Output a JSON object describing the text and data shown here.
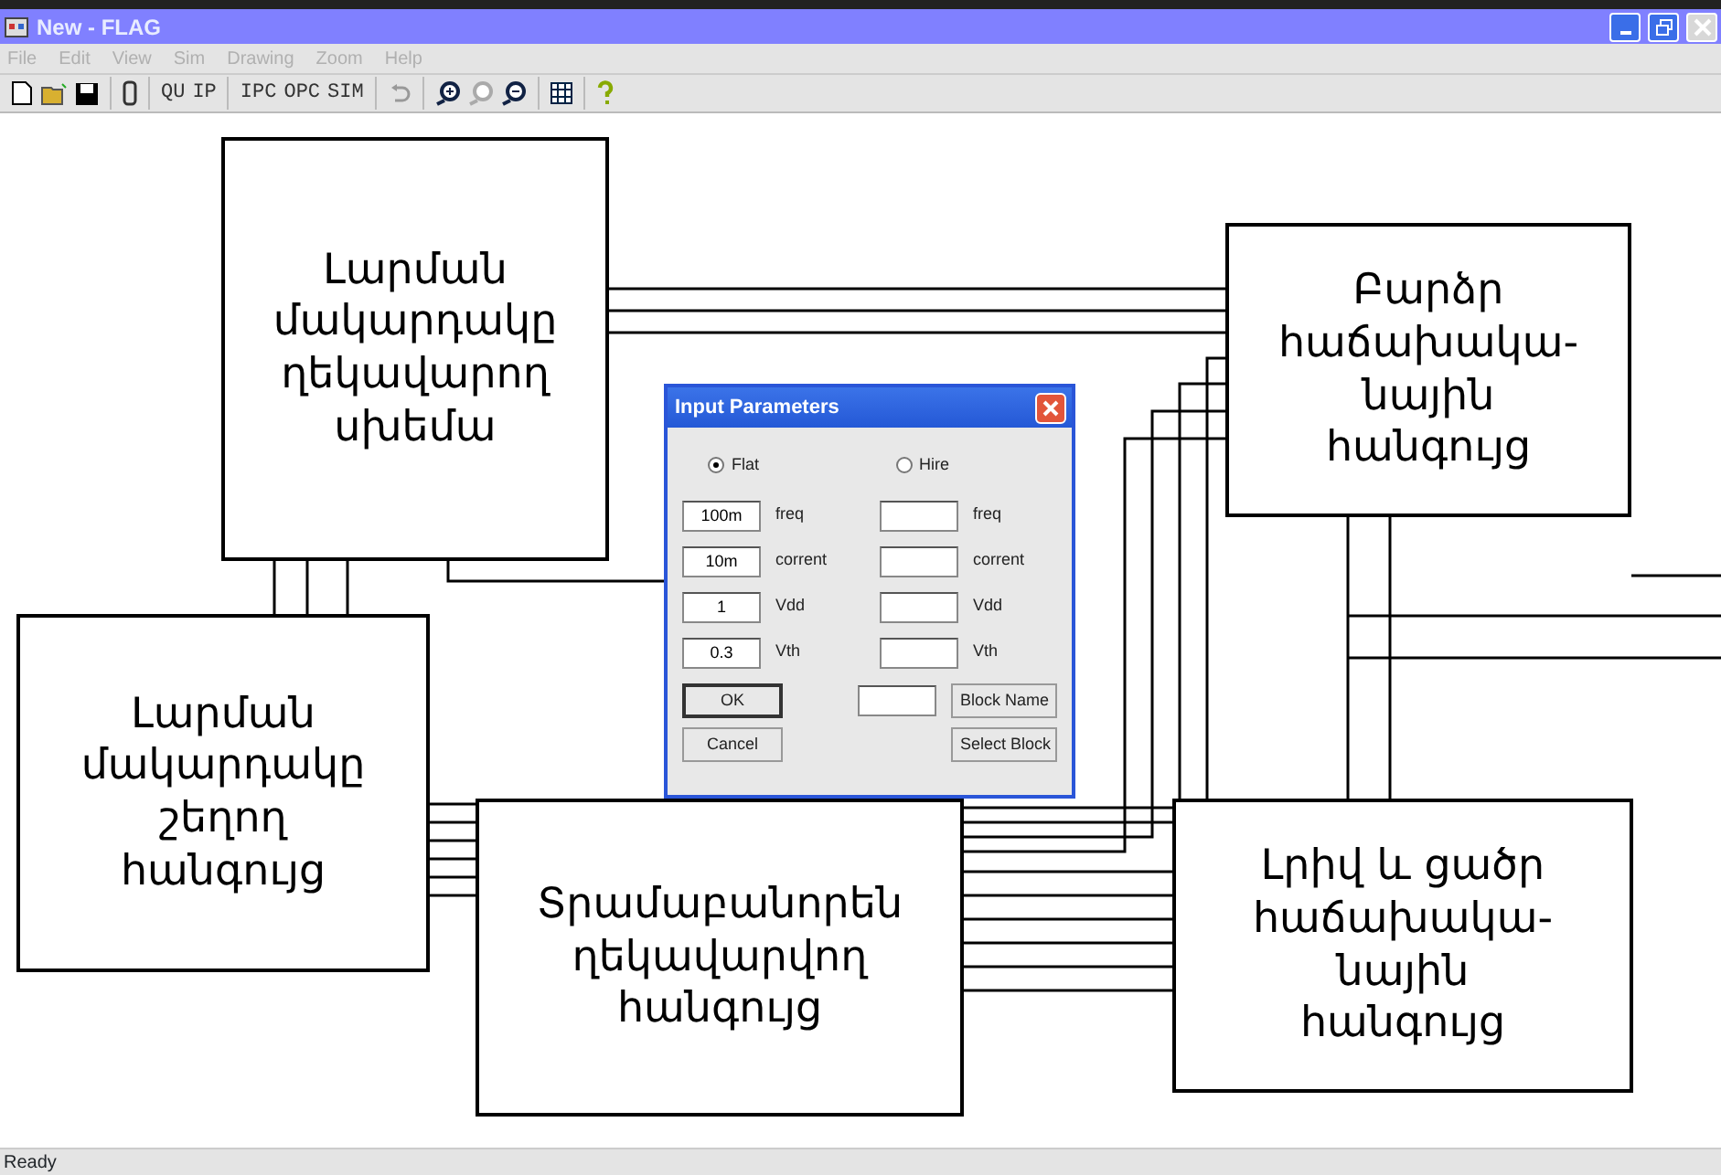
{
  "window": {
    "title": "New - FLAG"
  },
  "menu": [
    "File",
    "Edit",
    "View",
    "Sim",
    "Drawing",
    "Zoom",
    "Help"
  ],
  "toolbar_text_buttons": [
    "QU",
    "IP",
    "IPC",
    "OPC",
    "SIM"
  ],
  "blocks": [
    {
      "lines": [
        "Լարման",
        "մակարդակը",
        "ղեկավարող",
        "սխեմա"
      ]
    },
    {
      "lines": [
        "Բարձր",
        "հաճախակա-",
        "նային",
        "հանգույց"
      ]
    },
    {
      "lines": [
        "Լարման",
        "մակարդակը",
        "շեղող",
        "հանգույց"
      ]
    },
    {
      "lines": [
        "Տրամաբանորեն",
        "ղեկավարվող",
        "հանգույց"
      ]
    },
    {
      "lines": [
        "Լրիվ և ցածր",
        "հաճախակա-",
        "նային",
        "հանգույց"
      ]
    }
  ],
  "dialog": {
    "title": "Input Parameters",
    "modes": [
      {
        "label": "Flat",
        "selected": true
      },
      {
        "label": "Hire",
        "selected": false
      }
    ],
    "rows": [
      {
        "left_value": "100m",
        "left_label": "freq",
        "right_label": "freq"
      },
      {
        "left_value": "10m",
        "left_label": "corrent",
        "right_label": "corrent"
      },
      {
        "left_value": "1",
        "left_label": "Vdd",
        "right_label": "Vdd"
      },
      {
        "left_value": "0.3",
        "left_label": "Vth",
        "right_label": "Vth"
      }
    ],
    "buttons": {
      "ok": "OK",
      "cancel": "Cancel",
      "block_name": "Block Name",
      "select_block": "Select Block"
    }
  },
  "status_bar": "Ready"
}
